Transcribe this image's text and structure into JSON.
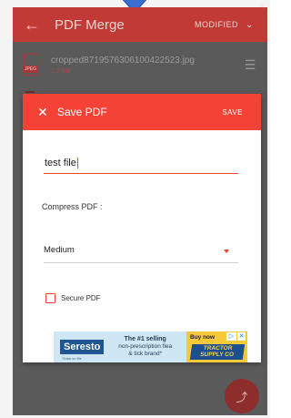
{
  "appbar": {
    "title": "PDF Merge",
    "sort_label": "MODIFIED",
    "back_icon": "arrow-left-icon",
    "sort_icon": "chevron-down-icon"
  },
  "files": [
    {
      "name": "cropped8719576306100422523.jpg",
      "size": "1.2 MB",
      "type_tag": "JPEG"
    }
  ],
  "dialog": {
    "title": "Save PDF",
    "save_label": "SAVE",
    "filename_value": "test file",
    "compress_label": "Compress PDF :",
    "compress_selected": "Medium",
    "secure_label": "Secure PDF",
    "secure_checked": false
  },
  "ad": {
    "brand": "Seresto",
    "brand_tagline": "*Data on file",
    "headline": "The #1 selling",
    "copy_line2": "non-prescription flea",
    "copy_line3": "& tick brand*",
    "cta": "Buy now",
    "store": "TRACTOR SUPPLY CO"
  },
  "colors": {
    "accent": "#f44336",
    "appbar_dim": "#c23a35",
    "overlay": "#5a5a5a",
    "ad_yellow": "#f6c93a",
    "ad_blue": "#1f5590"
  }
}
